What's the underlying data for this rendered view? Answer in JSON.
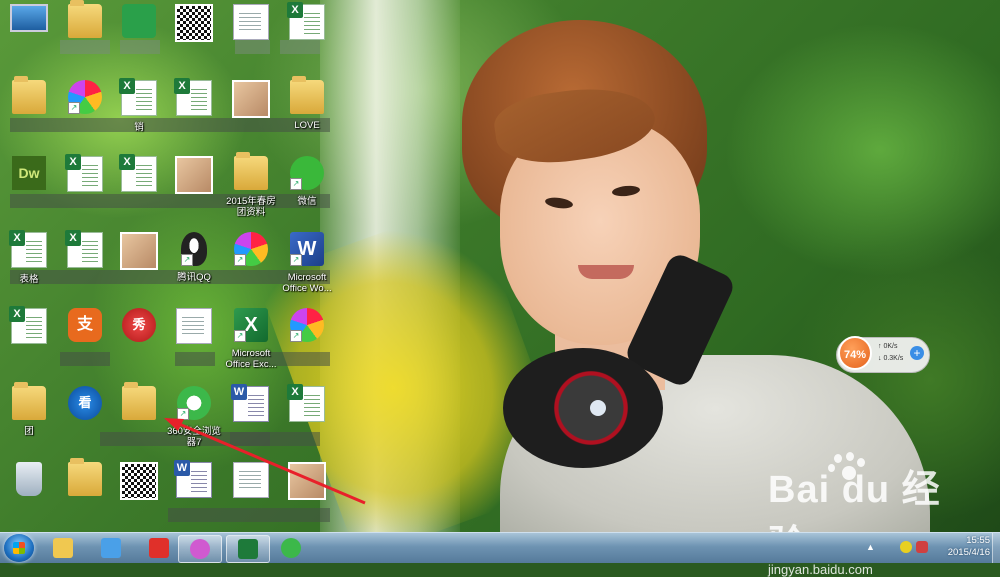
{
  "desktop": {
    "icons": [
      {
        "label": "",
        "kind": "computer"
      },
      {
        "label": "",
        "kind": "folder"
      },
      {
        "label": "",
        "kind": "dreamweaver"
      },
      {
        "label": "表格",
        "kind": "xls"
      },
      {
        "label": "",
        "kind": "xls"
      },
      {
        "label": "团",
        "kind": "folder"
      },
      {
        "label": "",
        "kind": "recycle"
      },
      {
        "label": "",
        "kind": "folder"
      },
      {
        "label": "",
        "kind": "pinwheel"
      },
      {
        "label": "",
        "kind": "xls"
      },
      {
        "label": "",
        "kind": "xls"
      },
      {
        "label": "",
        "kind": "alipay"
      },
      {
        "label": "",
        "kind": "kan"
      },
      {
        "label": "",
        "kind": "folder"
      },
      {
        "label": "",
        "kind": "greenapp"
      },
      {
        "label": "销",
        "kind": "xls"
      },
      {
        "label": "",
        "kind": "xls"
      },
      {
        "label": "",
        "kind": "psd"
      },
      {
        "label": "",
        "kind": "xiu"
      },
      {
        "label": "",
        "kind": "folder"
      },
      {
        "label": "",
        "kind": "qr"
      },
      {
        "label": "",
        "kind": "qr"
      },
      {
        "label": "",
        "kind": "xls"
      },
      {
        "label": "",
        "kind": "pic"
      },
      {
        "label": "腾讯QQ",
        "kind": "qq"
      },
      {
        "label": "",
        "kind": "doc"
      },
      {
        "label": "360安全浏览器7",
        "kind": "browser360"
      },
      {
        "label": "",
        "kind": "word"
      },
      {
        "label": "",
        "kind": "blank"
      },
      {
        "label": "",
        "kind": "pic"
      },
      {
        "label": "2015年春房团资料",
        "kind": "folder"
      },
      {
        "label": "",
        "kind": "pinwheel"
      },
      {
        "label": "Microsoft Office Exc...",
        "kind": "excel-shortcut"
      },
      {
        "label": "",
        "kind": "word"
      },
      {
        "label": "",
        "kind": "blank"
      },
      {
        "label": "",
        "kind": "xls"
      },
      {
        "label": "LOVE",
        "kind": "folder"
      },
      {
        "label": "微信",
        "kind": "wechat"
      },
      {
        "label": "Microsoft Office Wo...",
        "kind": "word-shortcut"
      },
      {
        "label": "",
        "kind": "pinwheel"
      },
      {
        "label": "",
        "kind": "xls"
      },
      {
        "label": "",
        "kind": "pic"
      }
    ]
  },
  "widget": {
    "percent": "74%",
    "up": "0K/s",
    "down": "0.3K/s"
  },
  "watermark": {
    "brand": "Bai du 经验",
    "url": "jingyan.baidu.com"
  },
  "taskbar": {
    "time": "15:55",
    "date": "2015/4/16",
    "buttons": [
      {
        "name": "explorer-taskbar",
        "color": "#f0c850"
      },
      {
        "name": "qq-pinyin-taskbar",
        "color": "#4aa0e8"
      },
      {
        "name": "browser-taskbar",
        "color": "#e0302a"
      },
      {
        "name": "pinwheel-taskbar",
        "color": "#d05ad0"
      },
      {
        "name": "excel-taskbar",
        "color": "#1e7a3a"
      },
      {
        "name": "360-taskbar",
        "color": "#3cb84a"
      }
    ]
  },
  "colors": {
    "arrow": "#e8202a",
    "taskbar": "#6e93b2"
  }
}
